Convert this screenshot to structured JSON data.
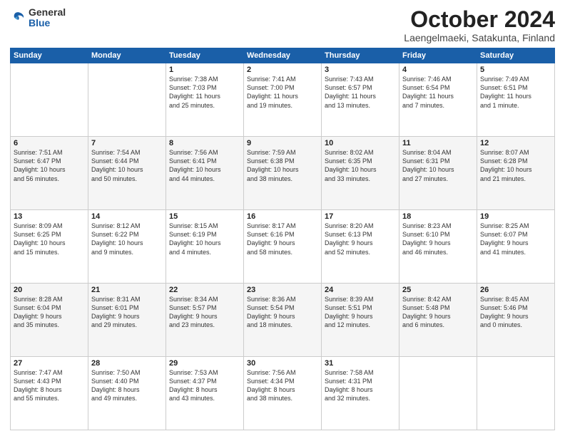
{
  "logo": {
    "general": "General",
    "blue": "Blue"
  },
  "title": {
    "month_year": "October 2024",
    "location": "Laengelmaeki, Satakunta, Finland"
  },
  "days_header": [
    "Sunday",
    "Monday",
    "Tuesday",
    "Wednesday",
    "Thursday",
    "Friday",
    "Saturday"
  ],
  "weeks": [
    [
      {
        "day": "",
        "text": ""
      },
      {
        "day": "",
        "text": ""
      },
      {
        "day": "1",
        "text": "Sunrise: 7:38 AM\nSunset: 7:03 PM\nDaylight: 11 hours\nand 25 minutes."
      },
      {
        "day": "2",
        "text": "Sunrise: 7:41 AM\nSunset: 7:00 PM\nDaylight: 11 hours\nand 19 minutes."
      },
      {
        "day": "3",
        "text": "Sunrise: 7:43 AM\nSunset: 6:57 PM\nDaylight: 11 hours\nand 13 minutes."
      },
      {
        "day": "4",
        "text": "Sunrise: 7:46 AM\nSunset: 6:54 PM\nDaylight: 11 hours\nand 7 minutes."
      },
      {
        "day": "5",
        "text": "Sunrise: 7:49 AM\nSunset: 6:51 PM\nDaylight: 11 hours\nand 1 minute."
      }
    ],
    [
      {
        "day": "6",
        "text": "Sunrise: 7:51 AM\nSunset: 6:47 PM\nDaylight: 10 hours\nand 56 minutes."
      },
      {
        "day": "7",
        "text": "Sunrise: 7:54 AM\nSunset: 6:44 PM\nDaylight: 10 hours\nand 50 minutes."
      },
      {
        "day": "8",
        "text": "Sunrise: 7:56 AM\nSunset: 6:41 PM\nDaylight: 10 hours\nand 44 minutes."
      },
      {
        "day": "9",
        "text": "Sunrise: 7:59 AM\nSunset: 6:38 PM\nDaylight: 10 hours\nand 38 minutes."
      },
      {
        "day": "10",
        "text": "Sunrise: 8:02 AM\nSunset: 6:35 PM\nDaylight: 10 hours\nand 33 minutes."
      },
      {
        "day": "11",
        "text": "Sunrise: 8:04 AM\nSunset: 6:31 PM\nDaylight: 10 hours\nand 27 minutes."
      },
      {
        "day": "12",
        "text": "Sunrise: 8:07 AM\nSunset: 6:28 PM\nDaylight: 10 hours\nand 21 minutes."
      }
    ],
    [
      {
        "day": "13",
        "text": "Sunrise: 8:09 AM\nSunset: 6:25 PM\nDaylight: 10 hours\nand 15 minutes."
      },
      {
        "day": "14",
        "text": "Sunrise: 8:12 AM\nSunset: 6:22 PM\nDaylight: 10 hours\nand 9 minutes."
      },
      {
        "day": "15",
        "text": "Sunrise: 8:15 AM\nSunset: 6:19 PM\nDaylight: 10 hours\nand 4 minutes."
      },
      {
        "day": "16",
        "text": "Sunrise: 8:17 AM\nSunset: 6:16 PM\nDaylight: 9 hours\nand 58 minutes."
      },
      {
        "day": "17",
        "text": "Sunrise: 8:20 AM\nSunset: 6:13 PM\nDaylight: 9 hours\nand 52 minutes."
      },
      {
        "day": "18",
        "text": "Sunrise: 8:23 AM\nSunset: 6:10 PM\nDaylight: 9 hours\nand 46 minutes."
      },
      {
        "day": "19",
        "text": "Sunrise: 8:25 AM\nSunset: 6:07 PM\nDaylight: 9 hours\nand 41 minutes."
      }
    ],
    [
      {
        "day": "20",
        "text": "Sunrise: 8:28 AM\nSunset: 6:04 PM\nDaylight: 9 hours\nand 35 minutes."
      },
      {
        "day": "21",
        "text": "Sunrise: 8:31 AM\nSunset: 6:01 PM\nDaylight: 9 hours\nand 29 minutes."
      },
      {
        "day": "22",
        "text": "Sunrise: 8:34 AM\nSunset: 5:57 PM\nDaylight: 9 hours\nand 23 minutes."
      },
      {
        "day": "23",
        "text": "Sunrise: 8:36 AM\nSunset: 5:54 PM\nDaylight: 9 hours\nand 18 minutes."
      },
      {
        "day": "24",
        "text": "Sunrise: 8:39 AM\nSunset: 5:51 PM\nDaylight: 9 hours\nand 12 minutes."
      },
      {
        "day": "25",
        "text": "Sunrise: 8:42 AM\nSunset: 5:48 PM\nDaylight: 9 hours\nand 6 minutes."
      },
      {
        "day": "26",
        "text": "Sunrise: 8:45 AM\nSunset: 5:46 PM\nDaylight: 9 hours\nand 0 minutes."
      }
    ],
    [
      {
        "day": "27",
        "text": "Sunrise: 7:47 AM\nSunset: 4:43 PM\nDaylight: 8 hours\nand 55 minutes."
      },
      {
        "day": "28",
        "text": "Sunrise: 7:50 AM\nSunset: 4:40 PM\nDaylight: 8 hours\nand 49 minutes."
      },
      {
        "day": "29",
        "text": "Sunrise: 7:53 AM\nSunset: 4:37 PM\nDaylight: 8 hours\nand 43 minutes."
      },
      {
        "day": "30",
        "text": "Sunrise: 7:56 AM\nSunset: 4:34 PM\nDaylight: 8 hours\nand 38 minutes."
      },
      {
        "day": "31",
        "text": "Sunrise: 7:58 AM\nSunset: 4:31 PM\nDaylight: 8 hours\nand 32 minutes."
      },
      {
        "day": "",
        "text": ""
      },
      {
        "day": "",
        "text": ""
      }
    ]
  ]
}
